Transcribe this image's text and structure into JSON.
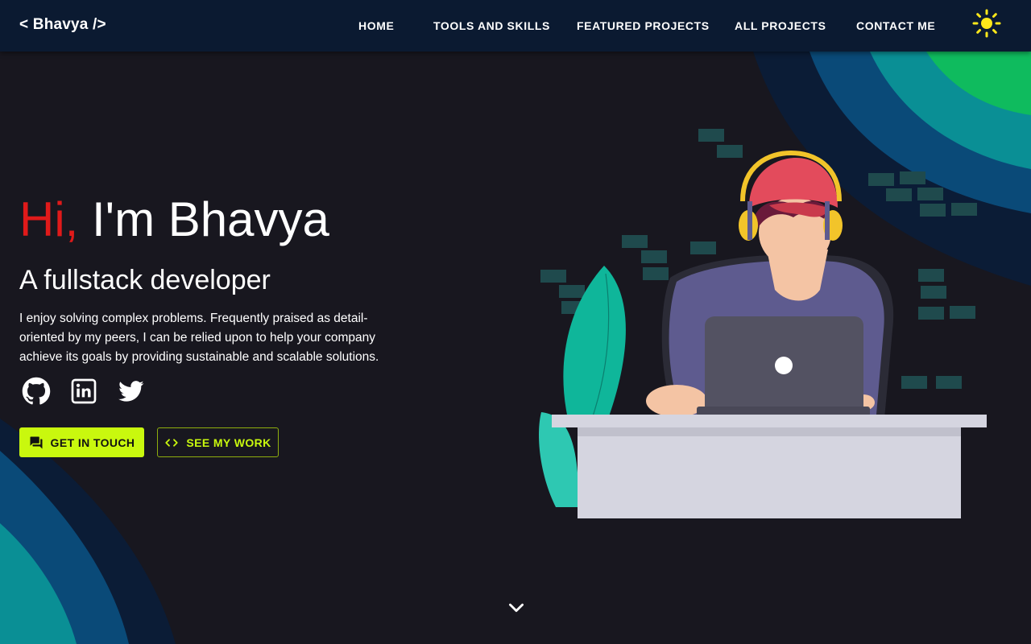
{
  "brand": {
    "logo": "< Bhavya />"
  },
  "nav": {
    "items": [
      {
        "label": "HOME"
      },
      {
        "label": "TOOLS AND SKILLS"
      },
      {
        "label": "FEATURED PROJECTS"
      },
      {
        "label": "ALL PROJECTS"
      },
      {
        "label": "CONTACT ME"
      }
    ],
    "theme_icon": "sun-icon"
  },
  "hero": {
    "greeting_prefix": "Hi,",
    "greeting_name": " I'm Bhavya",
    "subtitle": "A fullstack developer",
    "description": "I enjoy solving complex problems. Frequently praised as detail-oriented by my peers, I can be relied upon to help your company achieve its goals by providing sustainable and scalable solutions.",
    "social": [
      {
        "icon": "github-icon"
      },
      {
        "icon": "linkedin-icon"
      },
      {
        "icon": "twitter-icon"
      }
    ],
    "primary_button": {
      "label": "GET IN TOUCH",
      "icon": "chat-icon"
    },
    "secondary_button": {
      "label": "SEE MY WORK",
      "icon": "code-icon"
    },
    "scroll_icon": "chevron-down-icon"
  },
  "colors": {
    "accent": "#c9f80e",
    "greeting_hi": "#e01a1a",
    "background": "#18171f",
    "navbar": "#0b1a31",
    "sun": "#ffe81a"
  }
}
